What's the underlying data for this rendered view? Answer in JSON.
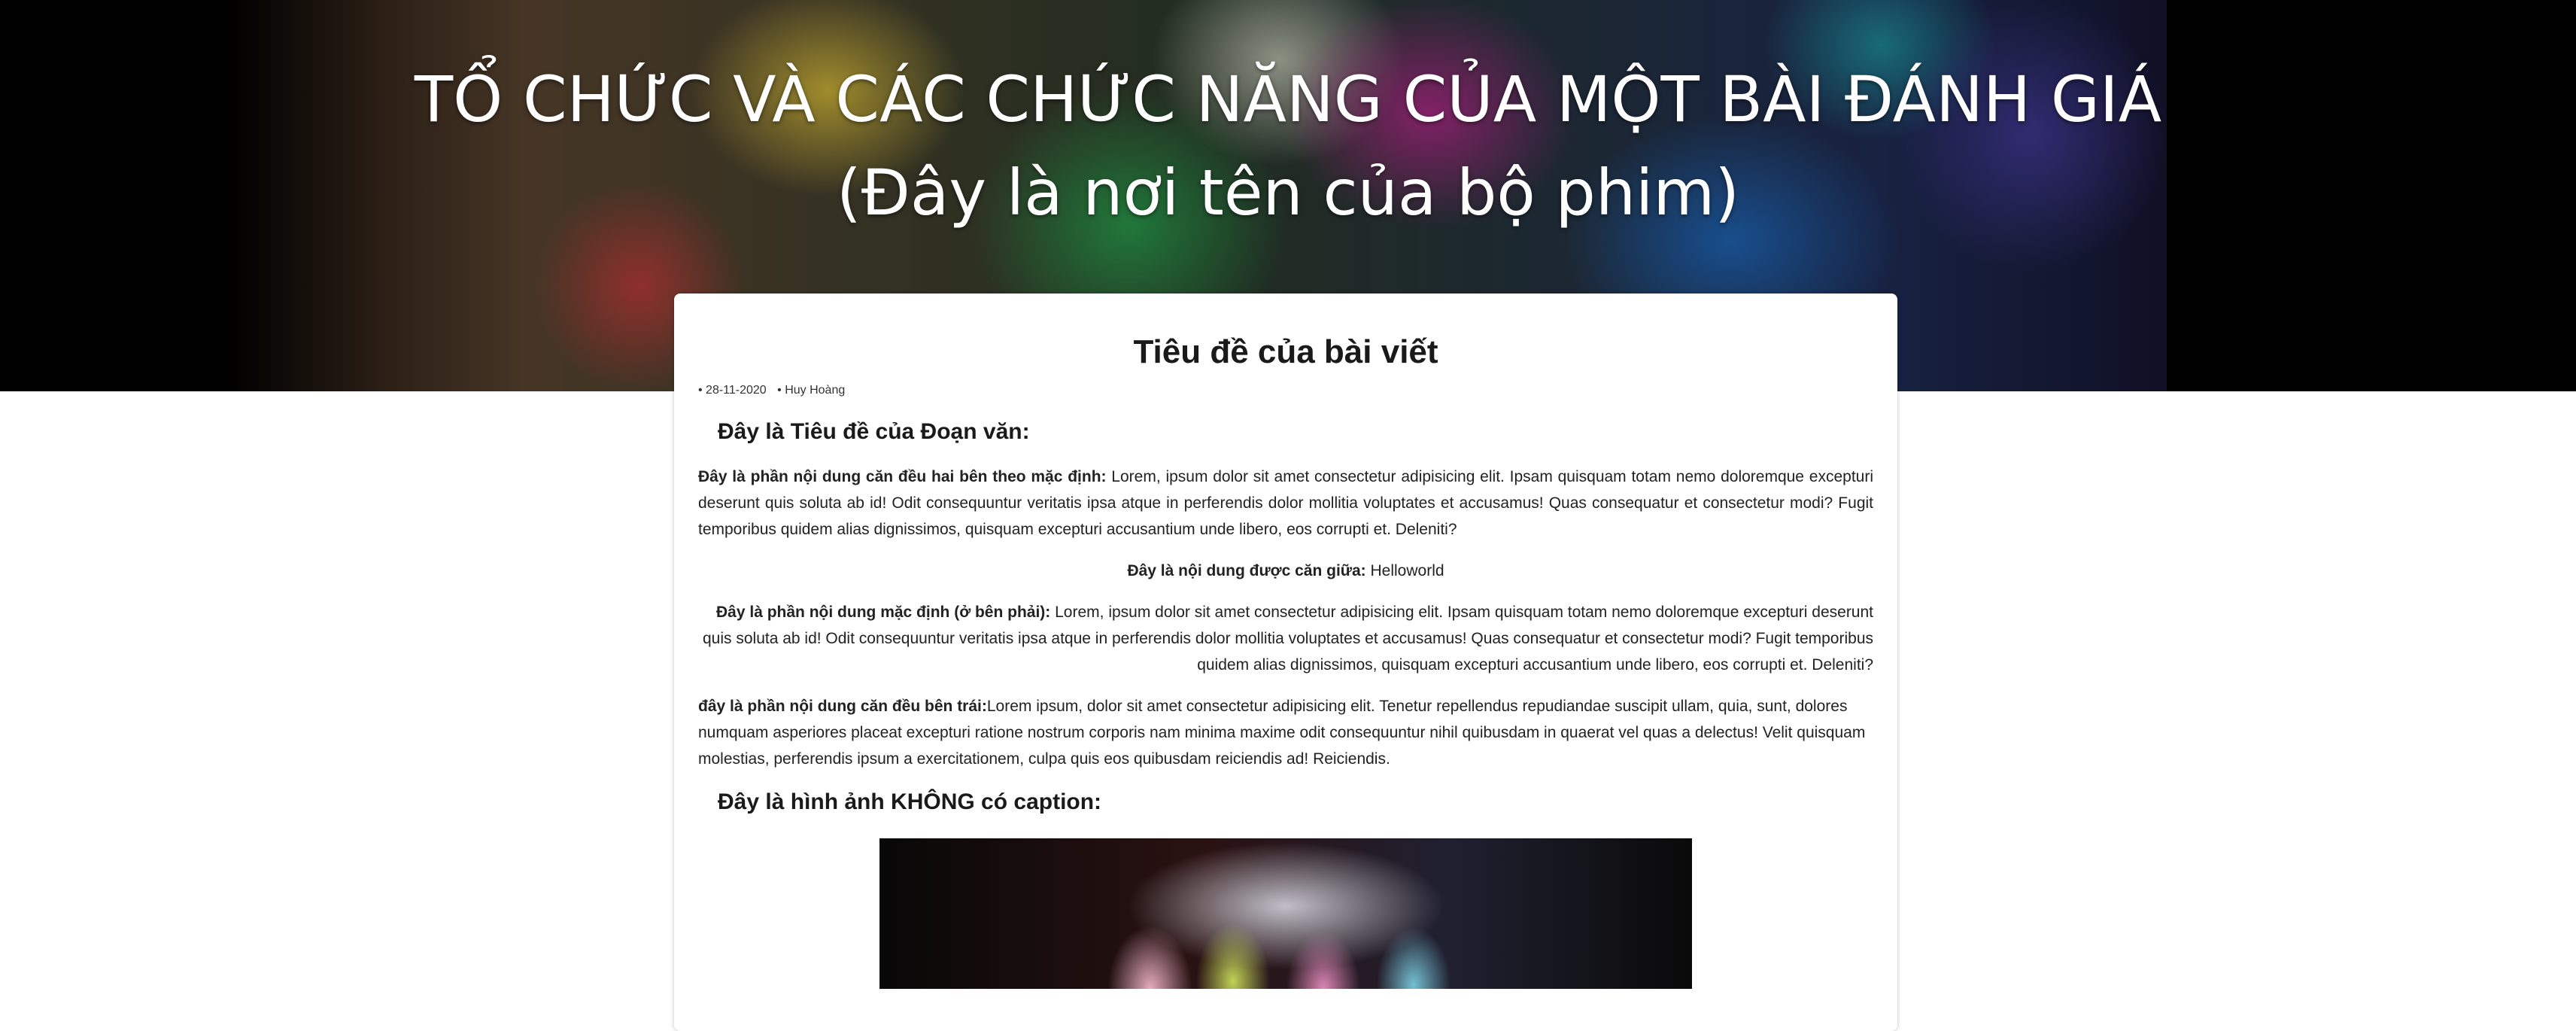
{
  "hero": {
    "line1": "TỔ CHỨC VÀ CÁC CHỨC NĂNG CỦA MỘT BÀI ĐÁNH GIÁ",
    "line2": "(Đây là nơi tên của bộ phim)"
  },
  "article": {
    "title": "Tiêu đề của bài viết",
    "meta": {
      "date": "• 28-11-2020",
      "author": "• Huy Hoàng"
    },
    "section1_title": "Đây là Tiêu đề của Đoạn văn:",
    "p_justify": {
      "label": "Đây là phần nội dung căn đều hai bên theo mặc định:",
      "text": " Lorem, ipsum dolor sit amet consectetur adipisicing elit. Ipsam quisquam totam nemo doloremque excepturi deserunt quis soluta ab id! Odit consequuntur veritatis ipsa atque in perferendis dolor mollitia voluptates et accusamus! Quas consequatur et consectetur modi? Fugit temporibus quidem alias dignissimos, quisquam excepturi accusantium unde libero, eos corrupti et. Deleniti?"
    },
    "p_center": {
      "label": "Đây là nội dung được căn giữa:",
      "text": " Helloworld"
    },
    "p_right": {
      "label": "Đây là phần nội dung mặc định (ở bên phải):",
      "text": " Lorem, ipsum dolor sit amet consectetur adipisicing elit. Ipsam quisquam totam nemo doloremque excepturi deserunt quis soluta ab id! Odit consequuntur veritatis ipsa atque in perferendis dolor mollitia voluptates et accusamus! Quas consequatur et consectetur modi? Fugit temporibus quidem alias dignissimos, quisquam excepturi accusantium unde libero, eos corrupti et. Deleniti?"
    },
    "p_left": {
      "label": "đây là phần nội dung căn đều bên trái:",
      "text": "Lorem ipsum, dolor sit amet consectetur adipisicing elit. Tenetur repellendus repudiandae suscipit ullam, quia, sunt, dolores numquam asperiores placeat excepturi ratione nostrum corporis nam minima maxime odit consequuntur nihil quibusdam in quaerat vel quas a delectus! Velit quisquam molestias, perferendis ipsum a exercitationem, culpa quis eos quibusdam reiciendis ad! Reiciendis."
    },
    "section2_title": "Đây là hình ảnh KHÔNG có caption:"
  }
}
